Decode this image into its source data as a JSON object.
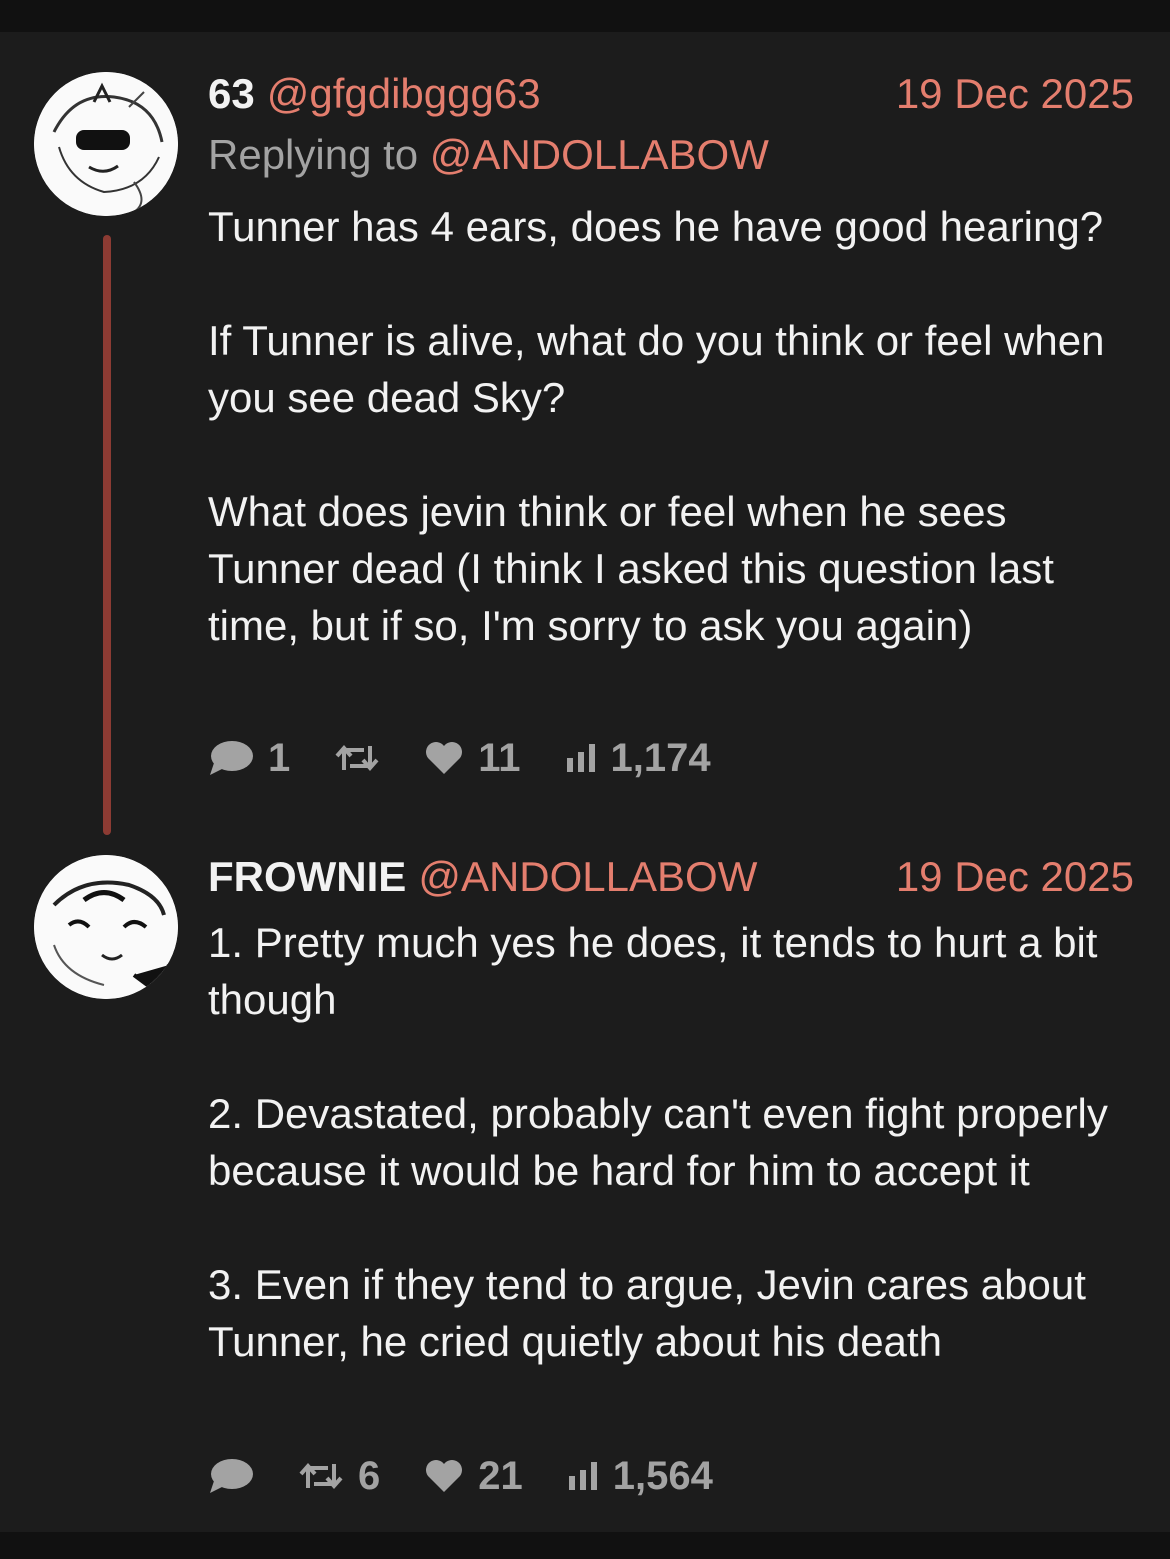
{
  "posts": [
    {
      "name": "63",
      "handle": "@gfgdibggg63",
      "date": "19 Dec 2025",
      "replying_label": "Replying to",
      "replying_handle": "@ANDOLLABOW",
      "paragraphs": [
        "Tunner has 4 ears, does he have good hearing?",
        "If Tunner is alive, what do you think or feel when you see dead Sky?",
        "What does jevin think or feel when he sees Tunner dead (I think I asked this question last time, but if so, I'm sorry to ask you again)"
      ],
      "stats": {
        "replies": "1",
        "reposts": "",
        "likes": "11",
        "views": "1,174"
      },
      "avatar_icon": "sketch-character-avatar"
    },
    {
      "name": "FROWNIE",
      "handle": "@ANDOLLABOW",
      "date": "19 Dec 2025",
      "paragraphs": [
        "1. Pretty much yes he does, it tends to hurt a bit though",
        "2. Devastated, probably can't even fight properly because it would be hard for him to accept it",
        "3. Even if they tend to argue, Jevin cares about Tunner, he cried quietly about his death"
      ],
      "stats": {
        "replies": "",
        "reposts": "6",
        "likes": "21",
        "views": "1,564"
      },
      "avatar_icon": "sketch-character-avatar"
    }
  ],
  "colors": {
    "background": "#1c1c1c",
    "accent": "#e47e6e",
    "thread_line": "#8c3b33",
    "muted": "#a3a3a3"
  },
  "icons": {
    "reply": "speech-bubble-icon",
    "repost": "repost-arrows-icon",
    "like": "heart-icon",
    "views": "bar-chart-icon"
  }
}
